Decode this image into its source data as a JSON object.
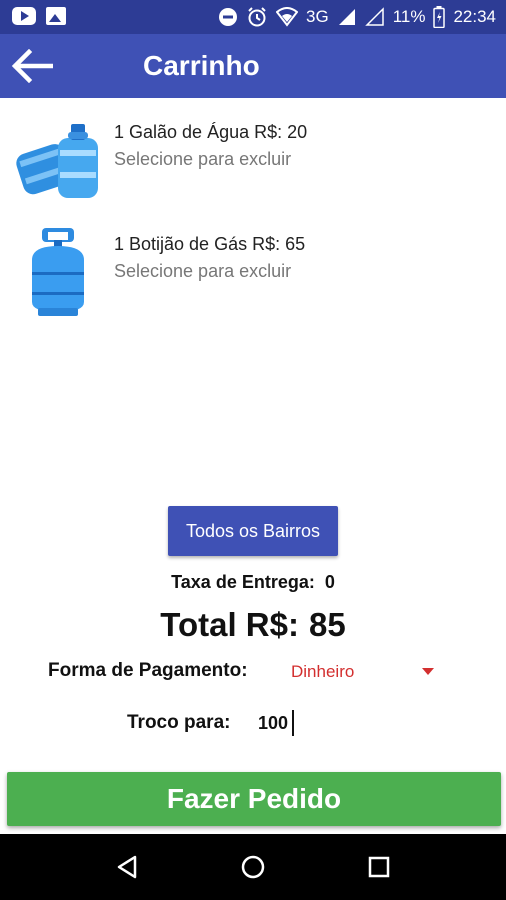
{
  "status_bar": {
    "signal_text": "3G",
    "battery": "11%",
    "time": "22:34",
    "icons": [
      "youtube-icon",
      "gallery-icon",
      "do-not-disturb-icon",
      "alarm-icon",
      "wifi-icon",
      "signal-icon",
      "battery-icon"
    ]
  },
  "app_bar": {
    "title": "Carrinho",
    "color": "#3f51b5",
    "back_icon": "arrow-left-icon"
  },
  "cart": {
    "items": [
      {
        "title": "1 Galão de Água R$: 20",
        "subtitle": "Selecione para excluir",
        "image": "water-jug"
      },
      {
        "title": "1 Botijão de Gás R$: 65",
        "subtitle": "Selecione para excluir",
        "image": "gas-cylinder"
      }
    ]
  },
  "bairros_button": {
    "label": "Todos os Bairros"
  },
  "taxa": {
    "label": "Taxa de Entrega:",
    "value": "0"
  },
  "total": {
    "label": "Total R$:",
    "value": "85"
  },
  "payment": {
    "label": "Forma de Pagamento:",
    "selected": "Dinheiro"
  },
  "troco": {
    "label": "Troco para:",
    "value": "100"
  },
  "order_button": {
    "label": "Fazer Pedido",
    "color": "#4caf50"
  },
  "nav_bar": {
    "icons": [
      "back-triangle-icon",
      "home-circle-icon",
      "recents-square-icon"
    ]
  }
}
